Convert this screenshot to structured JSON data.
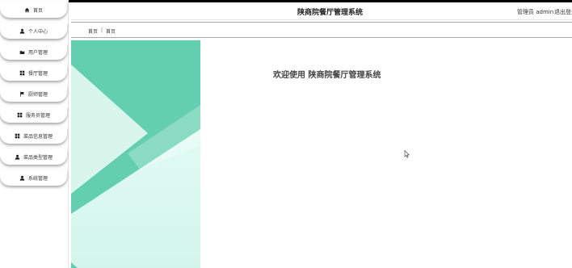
{
  "sidebar": {
    "items": [
      {
        "label": "首页",
        "icon": "home-icon"
      },
      {
        "label": "个人中心",
        "icon": "user-icon"
      },
      {
        "label": "用户管理",
        "icon": "folder-icon"
      },
      {
        "label": "餐厅管理",
        "icon": "grid-icon"
      },
      {
        "label": "厨师管理",
        "icon": "flag-icon"
      },
      {
        "label": "服务员管理",
        "icon": "grid-icon"
      },
      {
        "label": "菜品信息管理",
        "icon": "grid-icon"
      },
      {
        "label": "菜品类型管理",
        "icon": "user-icon"
      },
      {
        "label": "系统管理",
        "icon": "user-icon"
      }
    ]
  },
  "header": {
    "title": "陕商院餐厅管理系统",
    "admin": "管理员 admin",
    "logout": "退出登录"
  },
  "breadcrumb": {
    "home": "首页",
    "separator": "|",
    "current": "首页"
  },
  "main": {
    "welcome": "欢迎使用 陕商院餐厅管理系统"
  },
  "colors": {
    "accent": "#5fcfae",
    "accent_light": "#d8f7ee"
  }
}
